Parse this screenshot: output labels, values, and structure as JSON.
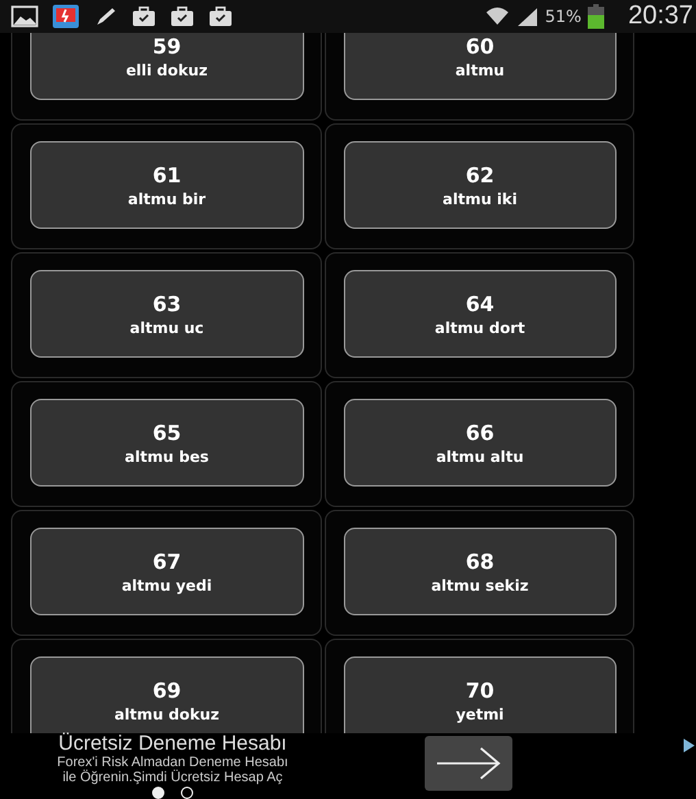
{
  "status_bar": {
    "battery": "51%",
    "time": "20:37"
  },
  "cards": [
    {
      "number": "59",
      "label": "elli dokuz"
    },
    {
      "number": "60",
      "label": "altmu"
    },
    {
      "number": "61",
      "label": "altmu bir"
    },
    {
      "number": "62",
      "label": "altmu iki"
    },
    {
      "number": "63",
      "label": "altmu uc"
    },
    {
      "number": "64",
      "label": "altmu dort"
    },
    {
      "number": "65",
      "label": "altmu bes"
    },
    {
      "number": "66",
      "label": "altmu altu"
    },
    {
      "number": "67",
      "label": "altmu yedi"
    },
    {
      "number": "68",
      "label": "altmu sekiz"
    },
    {
      "number": "69",
      "label": "altmu dokuz"
    },
    {
      "number": "70",
      "label": "yetmi"
    }
  ],
  "ad": {
    "title": "Ücretsiz Deneme Hesabı",
    "lines": [
      "Forex'i Risk Almadan Deneme Hesabı",
      "ile Öğrenin.Şimdi Ücretsiz Hesap Aç"
    ],
    "pages": [
      {
        "selected": true
      },
      {
        "selected": false
      }
    ]
  }
}
